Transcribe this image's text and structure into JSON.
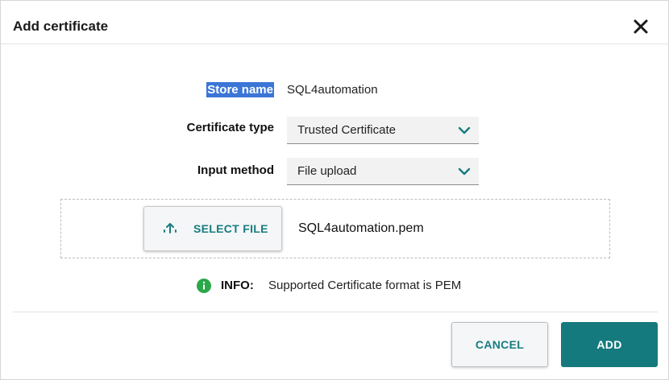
{
  "dialog": {
    "title": "Add certificate",
    "close_icon": "close-icon"
  },
  "form": {
    "store_name": {
      "label": "Store name",
      "value": "SQL4automation"
    },
    "certificate_type": {
      "label": "Certificate type",
      "value": "Trusted Certificate",
      "icon": "chevron-down-icon"
    },
    "input_method": {
      "label": "Input method",
      "value": "File upload",
      "icon": "chevron-down-icon"
    }
  },
  "upload": {
    "button_label": "SELECT FILE",
    "icon": "upload-icon",
    "file_name": "SQL4automation.pem"
  },
  "info": {
    "icon": "info-icon",
    "label": "INFO:",
    "text": "Supported Certificate format is PEM"
  },
  "footer": {
    "cancel_label": "CANCEL",
    "add_label": "ADD"
  },
  "colors": {
    "accent": "#157a7e",
    "selection_highlight": "#3b76d6",
    "info_green": "#2aa84a"
  }
}
